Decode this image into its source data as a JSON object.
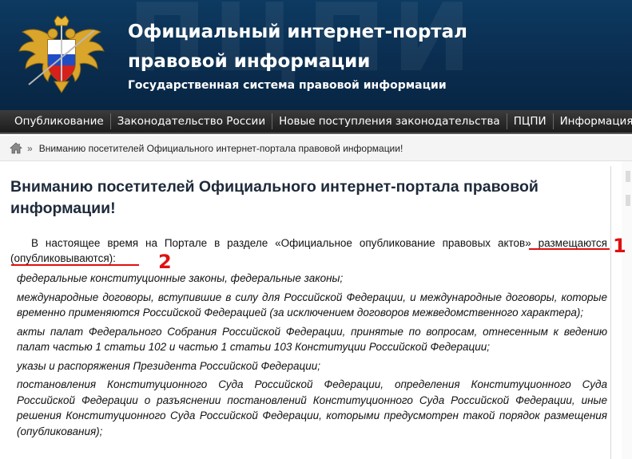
{
  "header": {
    "watermark": "ПЦПИ",
    "title": "Официальный интернет-портал правовой информации",
    "subtitle": "Государственная система правовой информации"
  },
  "nav": {
    "items": [
      {
        "label": "Опубликование"
      },
      {
        "label": "Законодательство России"
      },
      {
        "label": "Новые поступления законодательства"
      },
      {
        "label": "ПЦПИ"
      },
      {
        "label": "Информация"
      }
    ]
  },
  "breadcrumb": {
    "separator": "»",
    "current": "Вниманию посетителей Официального интернет-портала правовой информации!"
  },
  "main": {
    "title": "Вниманию посетителей Официального интернет-портала правовой информации!",
    "intro": "В настоящее время на Портале в разделе «Официальное опубликование правовых актов» размещаются (опубликовываются):",
    "items": [
      "федеральные конституционные законы, федеральные законы;",
      "международные договоры, вступившие в силу для Российской Федерации, и международные договоры, которые временно применяются Российской Федерацией (за исключением договоров межведомственного характера);",
      "акты палат Федерального Собрания Российской Федерации, принятые по вопросам, отнесенным к ведению палат частью 1 статьи 102 и частью 1 статьи 103 Конституции Российской Федерации;",
      "указы и распоряжения Президента Российской Федерации;",
      "постановления Конституционного Суда Российской Федерации, определения Конституционного Суда Российской Федерации о разъяснении постановлений Конституционного Суда Российской Федерации, иные решения Конституционного Суда Российской Федерации, которыми предусмотрен такой порядок размещения (опубликования);"
    ]
  },
  "annotations": {
    "marker1": "1",
    "marker2": "2",
    "color": "#e01010"
  }
}
